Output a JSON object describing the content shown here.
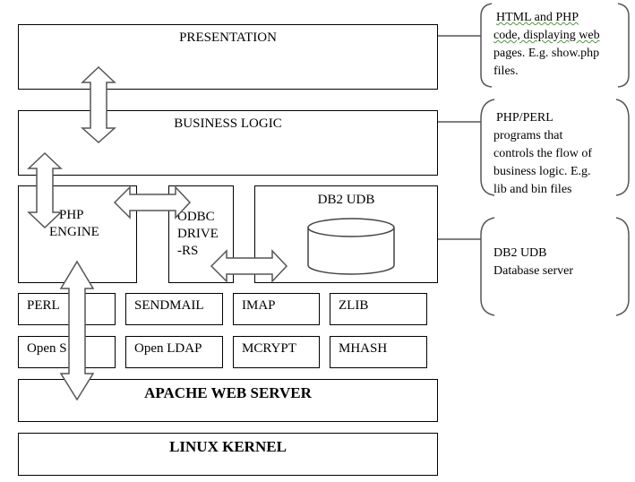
{
  "layers": {
    "presentation": "PRESENTATION",
    "business_logic": "BUSINESS LOGIC",
    "php_engine": [
      "PHP",
      "ENGINE"
    ],
    "odbc_drivers": [
      "ODBC",
      "DRIVE",
      "-RS"
    ],
    "db2": "DB2 UDB",
    "apache": "APACHE WEB SERVER",
    "linux": "LINUX KERNEL"
  },
  "libraries": {
    "row1": [
      "PERL",
      "SENDMAIL",
      "IMAP",
      "ZLIB"
    ],
    "row2": [
      "Open S",
      "Open LDAP",
      "MCRYPT",
      "MHASH"
    ]
  },
  "callouts": [
    {
      "lines": [
        "HTML and PHP",
        "code, displaying web",
        "pages. E.g. show.php",
        "files."
      ]
    },
    {
      "lines": [
        "PHP/PERL",
        "programs that",
        "controls the flow of",
        "business logic. E.g.",
        "lib and bin files"
      ]
    },
    {
      "lines": [
        "DB2 UDB",
        "Database server"
      ]
    }
  ]
}
